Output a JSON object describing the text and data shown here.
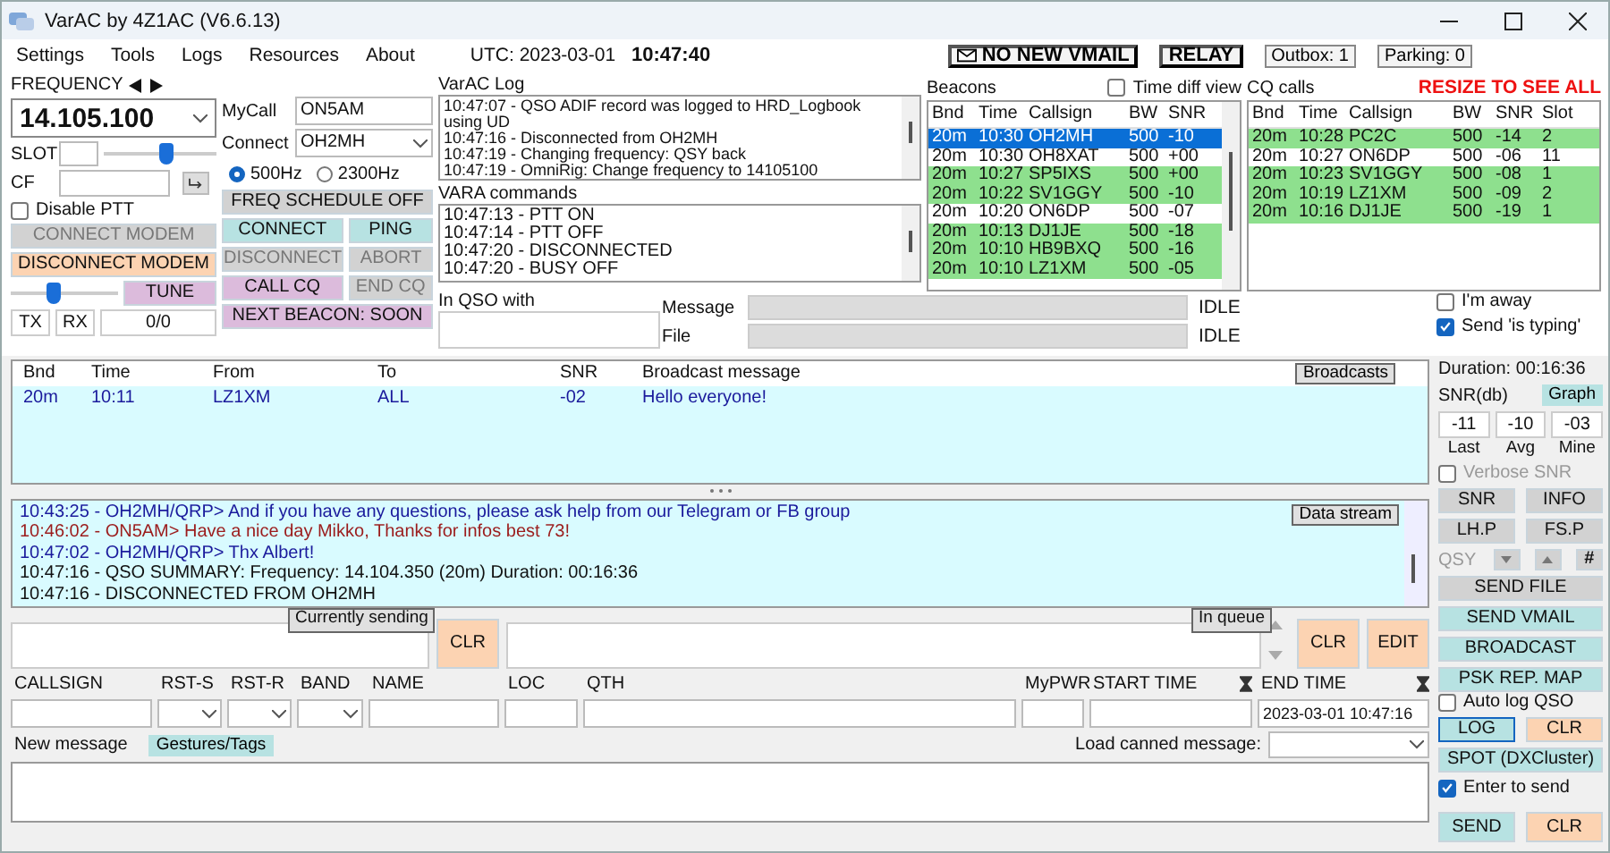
{
  "window": {
    "title": "VarAC by 4Z1AC (V6.6.13)"
  },
  "menu": [
    "Settings",
    "Tools",
    "Logs",
    "Resources",
    "About"
  ],
  "clock": {
    "date": "UTC: 2023-03-01",
    "time": "10:47:40"
  },
  "status_buttons": [
    {
      "label": "NO NEW VMAIL",
      "kind": "vmail"
    },
    {
      "label": "RELAY",
      "kind": "bold"
    },
    {
      "label": "Outbox: 1",
      "kind": "plain"
    },
    {
      "label": "Parking: 0",
      "kind": "plain"
    }
  ],
  "frequency": {
    "label": "FREQUENCY",
    "value": "14.105.100"
  },
  "slot": {
    "label": "SLOT",
    "level": 0.55
  },
  "cf": {
    "label": "CF"
  },
  "disable_ptt": {
    "label": "Disable PTT",
    "checked": false
  },
  "modem_buttons": [
    {
      "label": "CONNECT MODEM",
      "kind": "grey",
      "disabled": true
    },
    {
      "label": "DISCONNECT MODEM",
      "kind": "orange",
      "disabled": false
    }
  ],
  "tx_level": {
    "level": 0.4
  },
  "tune": {
    "label": "TUNE",
    "kind": "pink",
    "disabled": false
  },
  "tx_rx": [
    {
      "label": "TX"
    },
    {
      "label": "RX"
    },
    {
      "label": "0/0"
    }
  ],
  "mycall": {
    "label": "MyCall",
    "value": "ON5AM"
  },
  "connect": {
    "label": "Connect",
    "value": "OH2MH"
  },
  "bandwidth": [
    {
      "label": "500Hz",
      "selected": true
    },
    {
      "label": "2300Hz",
      "selected": false
    }
  ],
  "action_rows": [
    [
      {
        "label": "FREQ SCHEDULE OFF",
        "kind": "grey",
        "disabled": false
      }
    ],
    [
      {
        "label": "CONNECT",
        "kind": "teal",
        "disabled": false
      },
      {
        "label": "PING",
        "kind": "teal",
        "disabled": false
      }
    ],
    [
      {
        "label": "DISCONNECT",
        "kind": "grey",
        "disabled": true
      },
      {
        "label": "ABORT",
        "kind": "grey",
        "disabled": true
      }
    ],
    [
      {
        "label": "CALL CQ",
        "kind": "pink",
        "disabled": false
      },
      {
        "label": "END CQ",
        "kind": "grey",
        "disabled": true
      }
    ],
    [
      {
        "label": "NEXT BEACON: SOON",
        "kind": "pink",
        "disabled": false
      }
    ]
  ],
  "varac_log": {
    "title": "VarAC Log",
    "lines": [
      "10:47:07 - QSO ADIF record was logged to HRD_Logbook using UD",
      "10:47:16 - Disconnected from OH2MH",
      "10:47:19 - Changing frequency: QSY back",
      "10:47:19 - OmniRig: Change frequency to 14105100"
    ]
  },
  "vara_commands": {
    "title": "VARA commands",
    "lines": [
      "10:47:13 - PTT ON",
      "10:47:14 - PTT OFF",
      "10:47:20 - DISCONNECTED",
      "10:47:20 - BUSY OFF"
    ]
  },
  "in_qso": {
    "label": "In QSO with"
  },
  "transfers": [
    {
      "label": "Message",
      "status": "IDLE",
      "level": 0
    },
    {
      "label": "File",
      "status": "IDLE",
      "level": 0
    }
  ],
  "beacons": {
    "title": "Beacons",
    "time_diff": {
      "label": "Time diff view",
      "checked": false
    },
    "columns": [
      "Bnd",
      "Time",
      "Callsign",
      "BW",
      "SNR"
    ],
    "rows": [
      {
        "cells": [
          "20m",
          "10:30",
          "OH2MH",
          "500",
          "-10"
        ],
        "selected": true,
        "highlighted": false
      },
      {
        "cells": [
          "20m",
          "10:30",
          "OH8XAT",
          "500",
          "+00"
        ],
        "selected": false,
        "highlighted": false
      },
      {
        "cells": [
          "20m",
          "10:27",
          "SP5IXS",
          "500",
          "+00"
        ],
        "selected": false,
        "highlighted": true
      },
      {
        "cells": [
          "20m",
          "10:22",
          "SV1GGY",
          "500",
          "-10"
        ],
        "selected": false,
        "highlighted": true
      },
      {
        "cells": [
          "20m",
          "10:20",
          "ON6DP",
          "500",
          "-07"
        ],
        "selected": false,
        "highlighted": false
      },
      {
        "cells": [
          "20m",
          "10:13",
          "DJ1JE",
          "500",
          "-18"
        ],
        "selected": false,
        "highlighted": true
      },
      {
        "cells": [
          "20m",
          "10:10",
          "HB9BXQ",
          "500",
          "-16"
        ],
        "selected": false,
        "highlighted": true
      },
      {
        "cells": [
          "20m",
          "10:10",
          "LZ1XM",
          "500",
          "-05"
        ],
        "selected": false,
        "highlighted": true
      }
    ]
  },
  "cq_calls": {
    "title": "CQ calls",
    "warning": "RESIZE TO SEE ALL",
    "columns": [
      "Bnd",
      "Time",
      "Callsign",
      "BW",
      "SNR",
      "Slot"
    ],
    "rows": [
      {
        "cells": [
          "20m",
          "10:28",
          "PC2C",
          "500",
          "-14",
          "2"
        ],
        "highlighted": true
      },
      {
        "cells": [
          "20m",
          "10:27",
          "ON6DP",
          "500",
          "-06",
          "11"
        ],
        "highlighted": false
      },
      {
        "cells": [
          "20m",
          "10:23",
          "SV1GGY",
          "500",
          "-08",
          "1"
        ],
        "highlighted": true
      },
      {
        "cells": [
          "20m",
          "10:19",
          "LZ1XM",
          "500",
          "-09",
          "2"
        ],
        "highlighted": true
      },
      {
        "cells": [
          "20m",
          "10:16",
          "DJ1JE",
          "500",
          "-19",
          "1"
        ],
        "highlighted": true
      }
    ]
  },
  "presence": [
    {
      "label": "I'm away",
      "checked": false
    },
    {
      "label": "Send 'is typing'",
      "checked": true
    }
  ],
  "broadcasts": {
    "button": "Broadcasts",
    "columns": [
      "Bnd",
      "Time",
      "From",
      "To",
      "SNR",
      "Broadcast message"
    ],
    "rows": [
      {
        "cells": [
          "20m",
          "10:11",
          "LZ1XM",
          "ALL",
          "-02",
          "Hello everyone!"
        ]
      }
    ]
  },
  "data_stream": {
    "button": "Data stream",
    "lines": [
      {
        "text": "10:43:25 - OH2MH/QRP> And if you have any questions, please ask help from our Telegram or FB group",
        "kind": "remote"
      },
      {
        "text": "10:46:02 - ON5AM> Have a nice day Mikko, Thanks for infos best 73!",
        "kind": "local"
      },
      {
        "text": "10:47:02 - OH2MH/QRP> Thx Albert!",
        "kind": "remote"
      },
      {
        "text": "10:47:16 - QSO SUMMARY: Frequency: 14.104.350 (20m) Duration: 00:16:36",
        "kind": "system"
      },
      {
        "text": "10:47:16 - DISCONNECTED FROM OH2MH",
        "kind": "system"
      }
    ]
  },
  "sending": {
    "current_label": "Currently sending",
    "clear": "CLR",
    "queue_label": "In queue",
    "queue_clear": "CLR",
    "edit": "EDIT"
  },
  "qso_fields": [
    {
      "label": "CALLSIGN",
      "kind": "text"
    },
    {
      "label": "RST-S",
      "kind": "select"
    },
    {
      "label": "RST-R",
      "kind": "select"
    },
    {
      "label": "BAND",
      "kind": "select"
    },
    {
      "label": "NAME",
      "kind": "text"
    },
    {
      "label": "LOC",
      "kind": "text"
    },
    {
      "label": "QTH",
      "kind": "text"
    },
    {
      "label": "MyPWR",
      "kind": "text"
    },
    {
      "label": "START TIME",
      "kind": "timer"
    },
    {
      "label": "END TIME",
      "kind": "timer",
      "value": "2023-03-01 10:47:16"
    }
  ],
  "new_message": {
    "label": "New message",
    "tags_button": "Gestures/Tags",
    "canned_label": "Load canned message:"
  },
  "side": {
    "duration": "Duration: 00:16:36",
    "snr_title": "SNR(db)",
    "graph": "Graph",
    "snr": [
      {
        "value": "-11",
        "label": "Last"
      },
      {
        "value": "-10",
        "label": "Avg"
      },
      {
        "value": "-03",
        "label": "Mine"
      }
    ],
    "verbose": {
      "label": "Verbose SNR",
      "checked": false
    },
    "pairs": [
      [
        {
          "label": "SNR",
          "kind": "grey"
        },
        {
          "label": "INFO",
          "kind": "grey"
        }
      ],
      [
        {
          "label": "LH.P",
          "kind": "grey"
        },
        {
          "label": "FS.P",
          "kind": "grey"
        }
      ]
    ],
    "qsy": {
      "label": "QSY",
      "hash": "#"
    },
    "wide": [
      {
        "label": "SEND FILE",
        "kind": "grey"
      },
      {
        "label": "SEND VMAIL",
        "kind": "teal"
      },
      {
        "label": "BROADCAST",
        "kind": "teal"
      },
      {
        "label": "PSK REP. MAP",
        "kind": "teal"
      }
    ],
    "auto_log": {
      "label": "Auto log QSO",
      "checked": false
    },
    "log_pair": [
      {
        "label": "LOG",
        "kind": "teal"
      },
      {
        "label": "CLR",
        "kind": "orange"
      }
    ],
    "spot": {
      "label": "SPOT (DXCluster)",
      "kind": "teal"
    },
    "enter_to_send": {
      "label": "Enter to send",
      "checked": true
    },
    "send_pair": [
      {
        "label": "SEND",
        "kind": "teal"
      },
      {
        "label": "CLR",
        "kind": "orange"
      }
    ]
  }
}
